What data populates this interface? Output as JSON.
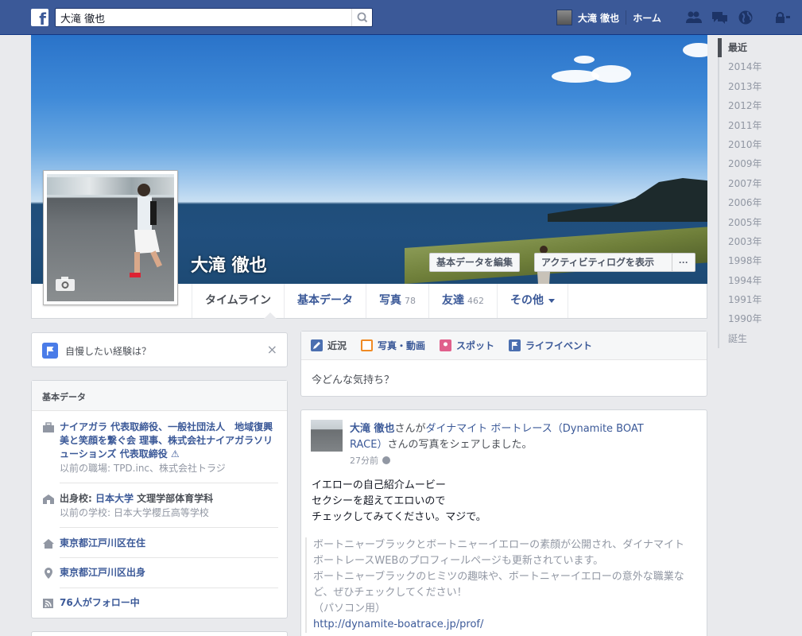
{
  "topbar": {
    "logo": "f",
    "search_value": "大滝 徹也",
    "user_name": "大滝 徹也",
    "home_label": "ホーム"
  },
  "profile": {
    "name": "大滝 徹也",
    "edit_about_button": "基本データを編集",
    "activity_log_button": "アクティビティログを表示",
    "more_button": "···"
  },
  "tabs": [
    {
      "label": "タイムライン",
      "count": ""
    },
    {
      "label": "基本データ",
      "count": ""
    },
    {
      "label": "写真",
      "count": "78"
    },
    {
      "label": "友達",
      "count": "462"
    },
    {
      "label": "その他",
      "count": ""
    }
  ],
  "brag": {
    "text": "自慢したい経験は？",
    "close": "×"
  },
  "about": {
    "header": "基本データ",
    "work_main": "ナイアガラ 代表取締役、一般社団法人　地域復興　美と笑顔を繋ぐ会 理事、株式会社ナイアガラソリューションズ 代表取締役",
    "work_sub": "以前の職場: TPD.inc、株式会社トラジ",
    "school_prefix": "出身校: ",
    "school_main": "日本大学",
    "school_rest": " 文理学部体育学科",
    "school_sub": "以前の学校: 日本大学櫻丘高等学校",
    "lives": "東京都江戸川区在住",
    "from": "東京都江戸川区出身",
    "followers": "76人がフォロー中"
  },
  "composer": {
    "tabs": [
      "近況",
      "写真・動画",
      "スポット",
      "ライフイベント"
    ],
    "placeholder": "今どんな気持ち？"
  },
  "post": {
    "author": "大滝 徹也",
    "text1": "さんが",
    "page_name": "ダイナマイト ボートレース（Dynamite BOAT RACE）",
    "text2": "さんの写真をシェアしました。",
    "time": "27分前",
    "body_line1": "イエローの自己紹介ムービー",
    "body_line2": "セクシーを超えてエロいので",
    "body_line3": "チェックしてみてください。マジで。",
    "quote_line1": "ボートニャーブラックとボートニャーイエローの素顔が公開され、ダイナマイト ボートレースWEBのプロフィールページも更新されています。",
    "quote_line2": "ボートニャーブラックのヒミツの趣味や、ボートニャーイエローの意外な職業など、ぜひチェックしてください！",
    "quote_line3": "（パソコン用）",
    "quote_link": "http://dynamite-boatrace.jp/prof/"
  },
  "years": [
    "最近",
    "2014年",
    "2013年",
    "2012年",
    "2011年",
    "2010年",
    "2009年",
    "2007年",
    "2006年",
    "2005年",
    "2003年",
    "1998年",
    "1994年",
    "1991年",
    "1990年",
    "誕生"
  ],
  "colors": {
    "brand": "#3b5998",
    "page_bg": "#e9eaed",
    "muted": "#9197a3"
  }
}
